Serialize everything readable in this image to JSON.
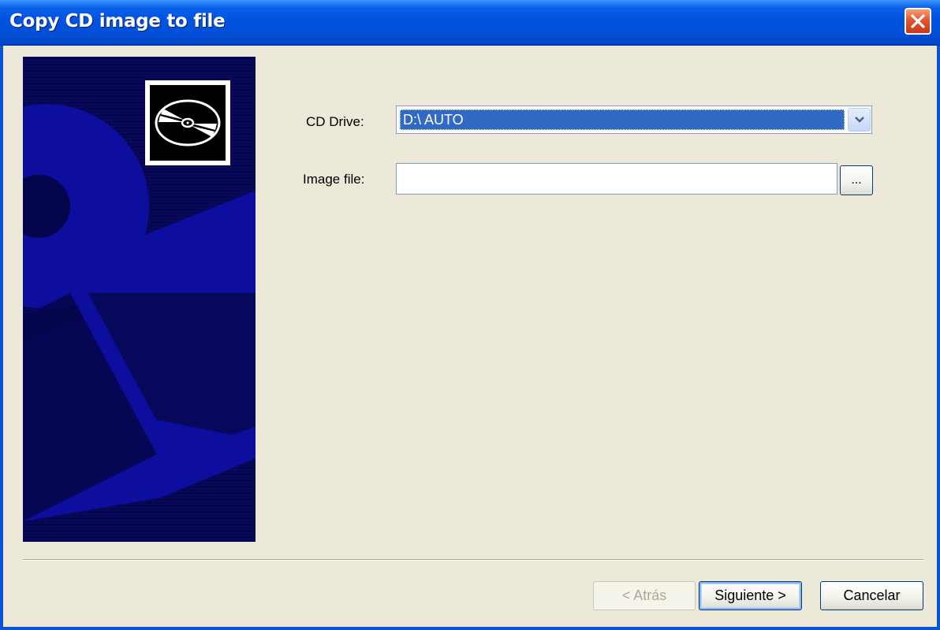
{
  "window": {
    "title": "Copy CD image to file"
  },
  "titlebar": {
    "close_icon": "close-x-icon"
  },
  "banner": {
    "icon": "cd-disc-icon"
  },
  "form": {
    "cd_drive_label": "CD Drive:",
    "cd_drive_value": "D:\\ AUTO",
    "image_file_label": "Image file:",
    "image_file_value": "",
    "browse_label": "..."
  },
  "footer": {
    "back_label": "< Atrás",
    "next_label": "Siguiente >",
    "cancel_label": "Cancelar"
  },
  "colors": {
    "title_bar": "#0053e1",
    "selection": "#316ac5",
    "banner_bg": "#05054d",
    "banner_shape": "#0d0d9e"
  }
}
